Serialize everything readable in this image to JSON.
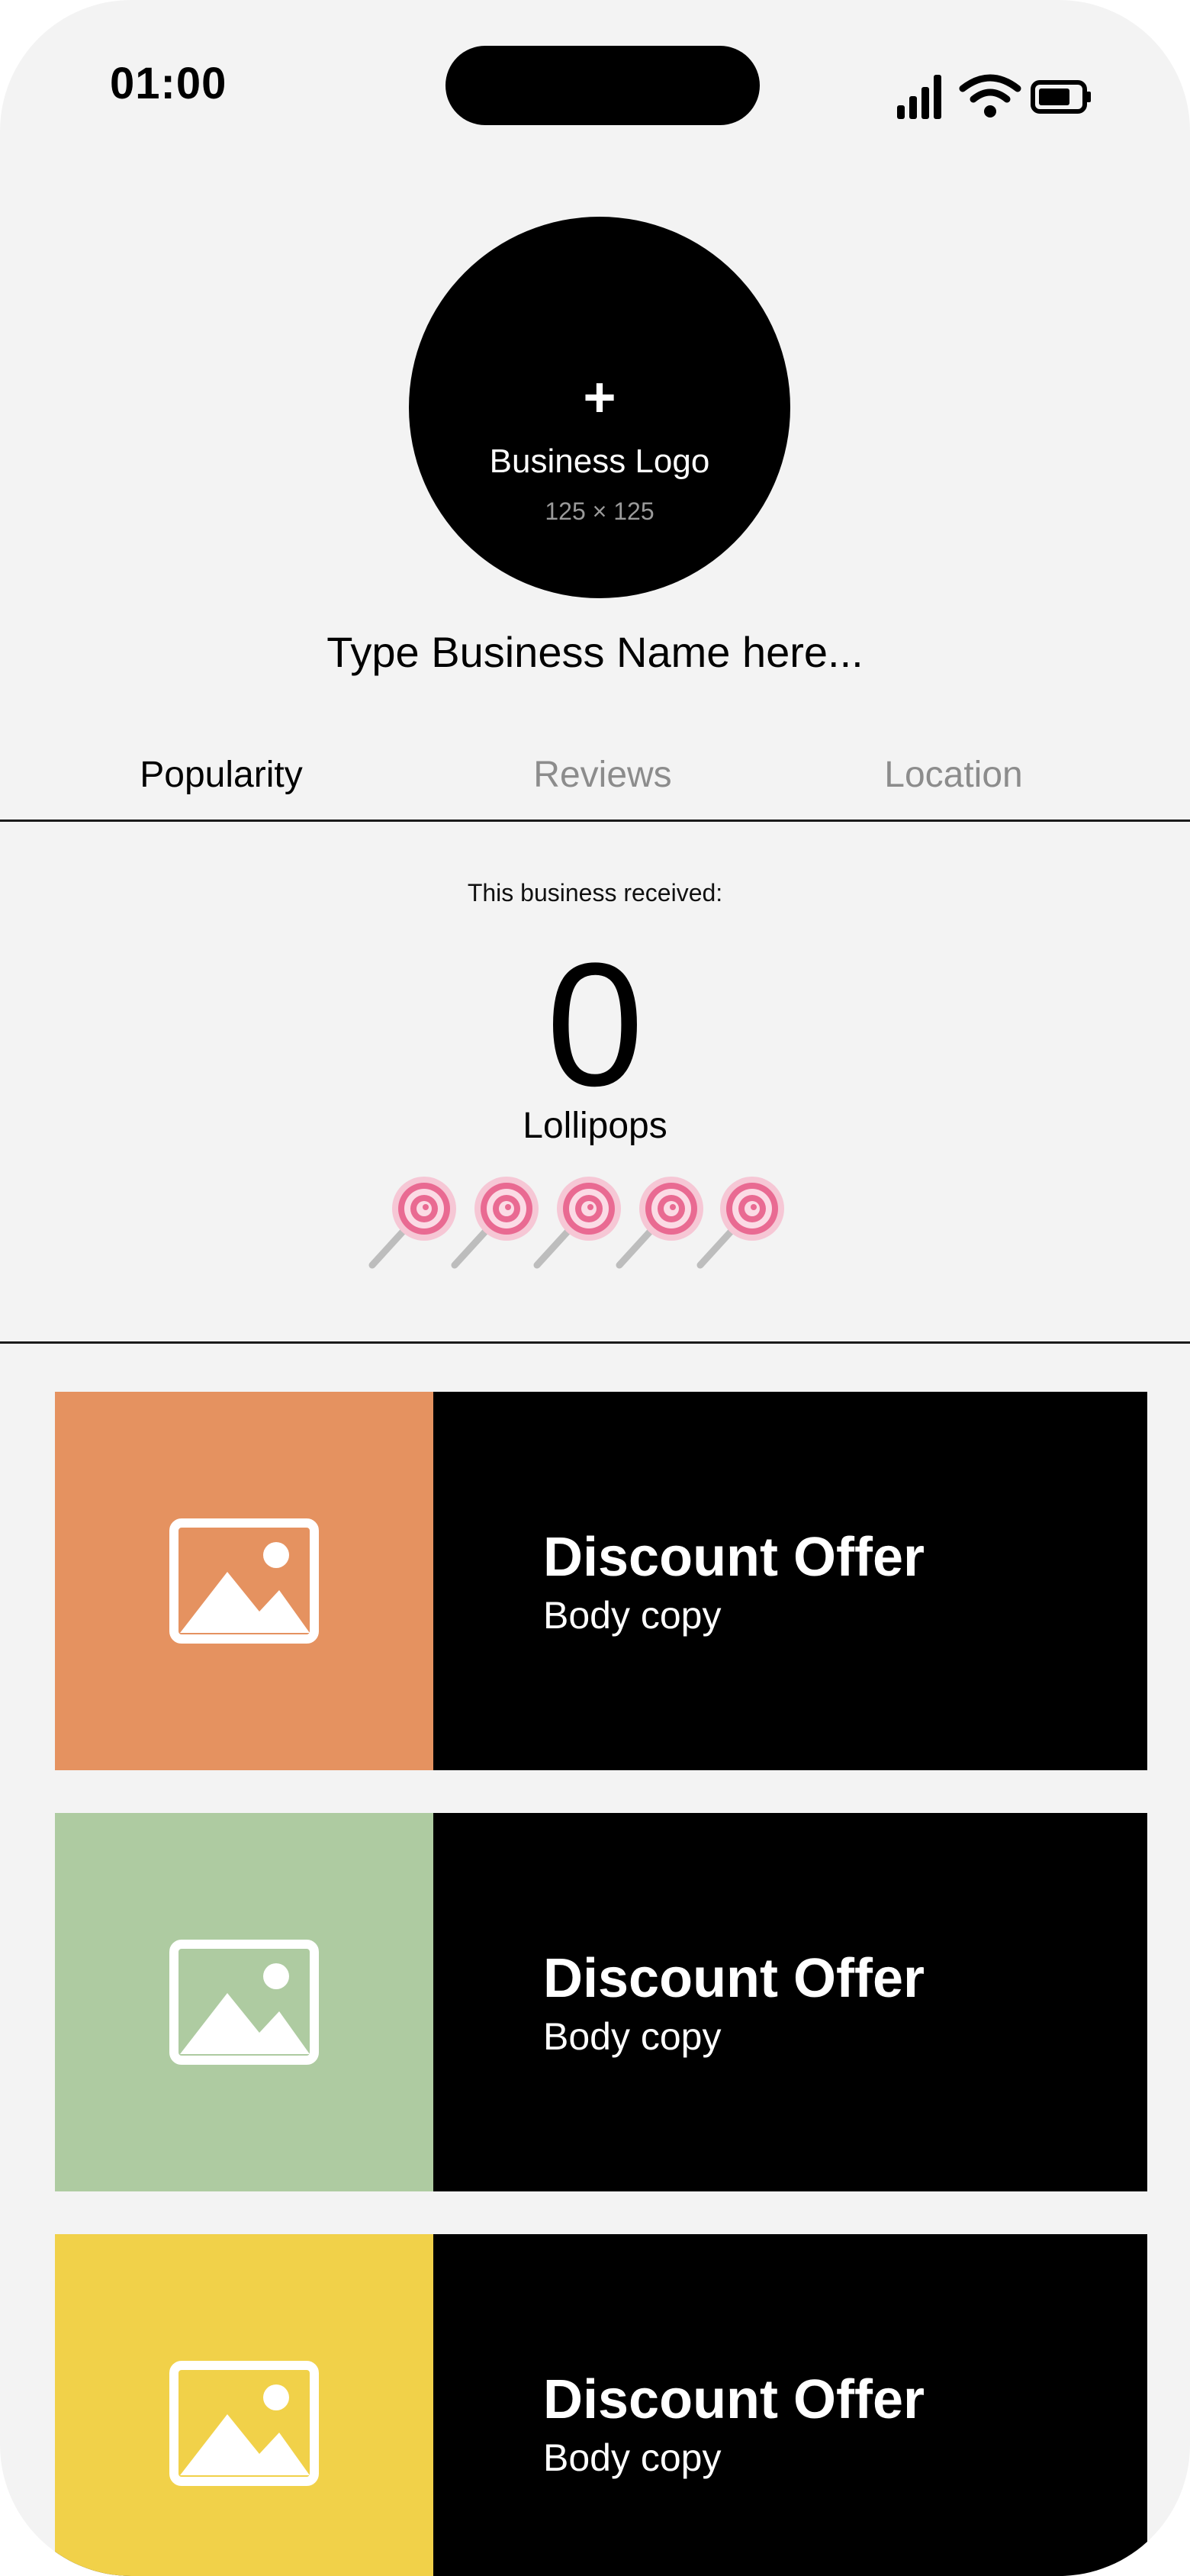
{
  "status_bar": {
    "time": "01:00",
    "icons": [
      "signal-icon",
      "wifi-icon",
      "battery-icon"
    ]
  },
  "logo": {
    "plus": "+",
    "label": "Business Logo",
    "size": "125 × 125"
  },
  "business_name": "Type Business Name here...",
  "tabs": [
    {
      "label": "Popularity",
      "active": true
    },
    {
      "label": "Reviews",
      "active": false
    },
    {
      "label": "Location",
      "active": false
    }
  ],
  "popularity": {
    "intro": "This business received:",
    "count": "0",
    "unit": "Lollipops",
    "rating_icons": 5,
    "rating_icon": "lollipop-icon"
  },
  "offers": [
    {
      "title": "Discount Offer",
      "body": "Body copy",
      "color": "#E59260",
      "icon": "image-placeholder-icon"
    },
    {
      "title": "Discount Offer",
      "body": "Body copy",
      "color": "#AECBA1",
      "icon": "image-placeholder-icon"
    },
    {
      "title": "Discount Offer",
      "body": "Body copy",
      "color": "#F1D149",
      "icon": "image-placeholder-icon"
    }
  ]
}
